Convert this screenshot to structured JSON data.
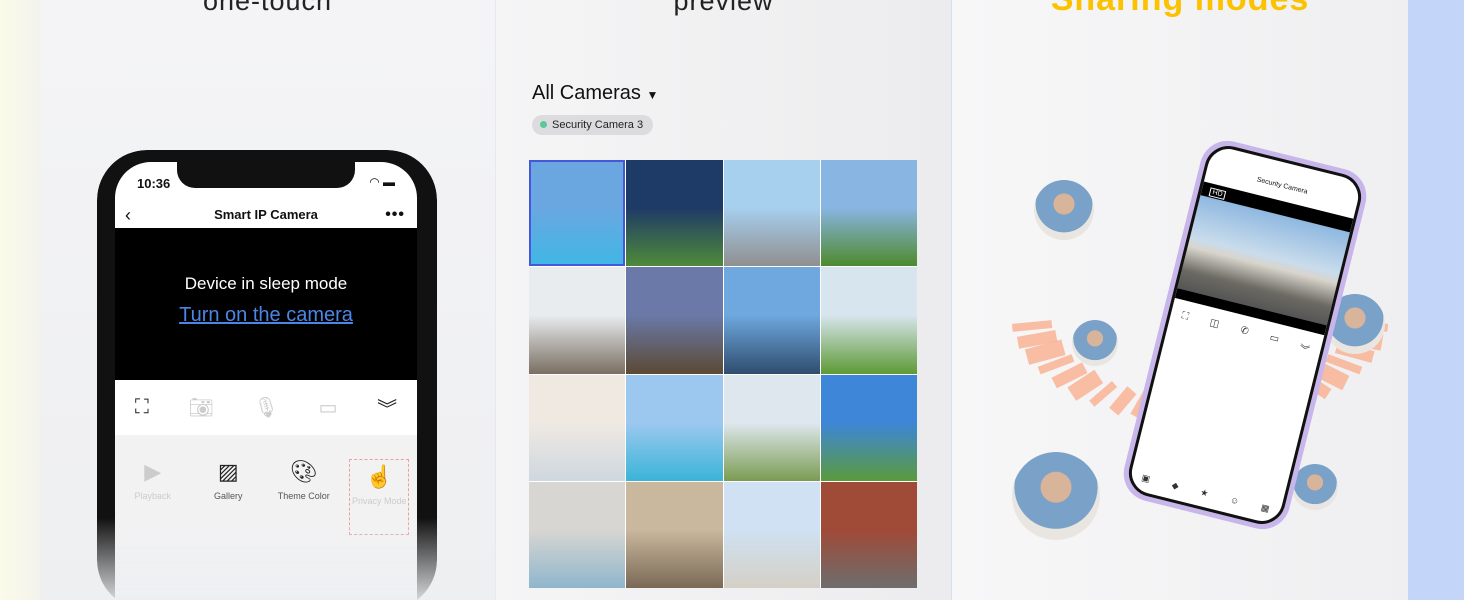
{
  "panels": [
    {
      "title": "one-touch"
    },
    {
      "title": "preview"
    },
    {
      "title": "Sharing modes"
    }
  ],
  "phone1": {
    "time": "10:36",
    "title": "Smart IP Camera",
    "sleep_message": "Device in sleep mode",
    "wake_link": "Turn on the camera",
    "menu": [
      {
        "label": "Playback",
        "icon": "play-icon"
      },
      {
        "label": "Gallery",
        "icon": "image-icon"
      },
      {
        "label": "Theme Color",
        "icon": "palette-icon"
      },
      {
        "label": "Privacy Mode",
        "icon": "privacy-icon"
      }
    ]
  },
  "preview": {
    "selector": "All Cameras",
    "selected_camera": "Security Camera 3",
    "status_color": "#5cc89a",
    "camera_count": 16
  },
  "phone3": {
    "title": "Security Camera",
    "quality_badge": "HD"
  },
  "colors": {
    "accent_yellow": "#fcc200",
    "link_blue": "#4b86e6",
    "ray_orange": "#f9b08f",
    "selection_blue": "#4458d8"
  }
}
